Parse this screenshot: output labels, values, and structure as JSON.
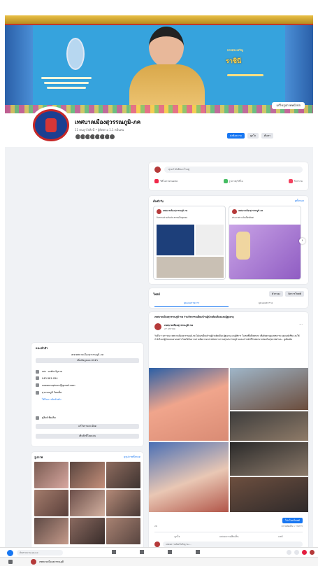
{
  "profile": {
    "name": "เทศบาลเมืองสุวรรณภูมิ-ภค",
    "meta": "11 คนถูกใจสิ่งนี้ • ผู้ติดตาม 1.1 หมื่นคน"
  },
  "cover": {
    "headline": "ทรงพระเจริญ",
    "name_text": "ราชินี",
    "edit_label": "แก้ไขรูปภาพหน้าปก"
  },
  "header_buttons": {
    "message": "ส่งข้อความ",
    "like": "ถูกใจ",
    "search": "ค้นหา"
  },
  "create_post": {
    "placeholder": "คุณกำลังคิดอะไรอยู่",
    "actions": [
      "วิดีโอถ่ายทอดสด",
      "รูปภาพ/วิดีโอ",
      "กิจกรรม"
    ]
  },
  "featured": {
    "title": "ต้นตำรับ",
    "see_all": "ดูทั้งหมด",
    "cards": [
      {
        "name": "เทศบาลเมืองสุวรรณภูมิ-ภค",
        "text": "กิจกรรมร่วมกับประชาชนในชุมชน"
      },
      {
        "name": "เทศบาลเมืองสุวรรณภูมิ-ภค",
        "text": "ประกาศรางวัลเกียรติยศ"
      }
    ]
  },
  "posts_section": {
    "title": "โพสต์",
    "filter_label": "ตัวกรอง",
    "manage_label": "จัดการโพสต์",
    "tabs": [
      "มุมมองรายการ",
      "มุมมองตาราง"
    ]
  },
  "post": {
    "header_text": "เทศบาลเมืองสุวรรณภูมิ-ภค ร่วมกิจกรรมเยี่ยมบ้านผู้ป่วยติดเตียงและผู้สูงอายุ",
    "author": "เทศบาลเมืองสุวรรณภูมิ-ภค",
    "date": "27 มกราคม",
    "body": "วันที่ 27 มกราคม เทศบาลเมืองสุวรรณภูมิ-ภค ได้ออกเยี่ยมบ้านผู้ป่วยติดเตียง ผู้สูงอายุ และผู้พิการ ในเขตพื้นที่เทศบาล เพื่อติดตามดูแลสุขภาพ มอบถุงยังชีพ และให้กำลังใจแก่ผู้ป่วยและครอบครัว โดยได้รับความร่วมมือจากอาสาสมัครสาธารณสุขประจำหมู่บ้านและเจ้าหน้าที่โรงพยาบาลส่งเสริมสุขภาพตำบล... ดูเพิ่มเติม",
    "stats_left": "26",
    "stats_right": "ความคิดเห็น 1 รายการ",
    "boost_label": "โปรโมทโพสต์",
    "actions": [
      "ถูกใจ",
      "แสดงความคิดเห็น",
      "แชร์"
    ],
    "comment_placeholder": "แสดงความคิดเห็นในฐานะ..."
  },
  "intro": {
    "title": "แนะนำตัว",
    "description": "เพจเทศบาลเมืองสุวรรณภูมิ-ภค",
    "add_bio": "เพิ่มข้อมูลแนะนำตัว",
    "rows": [
      "เพจ · องค์กรรัฐบาล",
      "043-581-054",
      "suwannaphum@gmail.com",
      "สุวรรณภูมิ ร้อยเอ็ด",
      "ได้รับการจัดอันดับ",
      "ดูลิงก์เพิ่มเติม"
    ],
    "btn_edit": "แก้ไขรายละเอียด",
    "btn_featured": "เพิ่มสิ่งที่โดดเด่น"
  },
  "photos": {
    "title": "รูปภาพ",
    "see_all": "ดูรูปภาพทั้งหมด"
  },
  "taskbar": {
    "search": "ค้นหาบน Facebook"
  },
  "bottom": {
    "label": "เทศบาลเมืองสุวรรณภูมิ"
  },
  "colors": {
    "brand": "#1877f2",
    "cover_sky": "#36a3dd",
    "seal_red": "#c62828"
  }
}
